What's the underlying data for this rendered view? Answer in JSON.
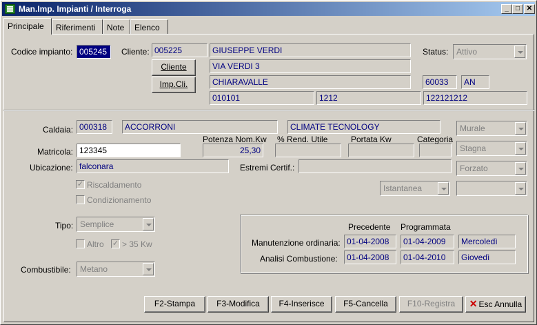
{
  "window": {
    "title": "Man.Imp. Impianti / Interroga",
    "min": "_",
    "max": "□",
    "close": "✕"
  },
  "tabs": [
    "Principale",
    "Riferimenti",
    "Note",
    "Elenco"
  ],
  "top": {
    "codice_label": "Codice impianto:",
    "codice_value": "005245",
    "cliente_label": "Cliente:",
    "cliente_code": "005225",
    "cliente_name": "GIUSEPPE VERDI",
    "status_label": "Status:",
    "status_value": "Attivo",
    "address": "VIA VERDI 3",
    "city": "CHIARAVALLE",
    "cap": "60033",
    "prov": "AN",
    "cliente_btn": "Cliente",
    "impcli_btn": "Imp.Cli.",
    "f1": "010101",
    "f2": "1212",
    "f3": "122121212"
  },
  "caldaia": {
    "label": "Caldaia:",
    "code": "000318",
    "brand": "ACCORRONI",
    "model": "CLIMATE TECNOLOGY",
    "combo1": "Murale",
    "matricola_label": "Matricola:",
    "matricola": "123345",
    "potenza_label": "Potenza Nom.Kw",
    "potenza": "25,30",
    "rend_label": "% Rend. Utile",
    "portata_label": "Portata Kw",
    "categoria_label": "Categoria",
    "combo2": "Stagna",
    "ubicazione_label": "Ubicazione:",
    "ubicazione": "falconara",
    "estremi_label": "Estremi Certif.:",
    "combo3": "Forzato",
    "riscaldamento": "Riscaldamento",
    "condizionamento": "Condizionamento",
    "istantanea": "Istantanea",
    "combo4": ""
  },
  "tipo": {
    "label": "Tipo:",
    "value": "Semplice",
    "altro": "Altro",
    "gt35": "> 35 Kw",
    "combustibile_label": "Combustibile:",
    "combustibile": "Metano"
  },
  "manut": {
    "precedente": "Precedente",
    "programmata": "Programmata",
    "ordinaria_label": "Manutenzione ordinaria:",
    "ord_prec": "01-04-2008",
    "ord_prog": "01-04-2009",
    "ord_day": "Mercoledì",
    "analisi_label": "Analisi Combustione:",
    "an_prec": "01-04-2008",
    "an_prog": "01-04-2010",
    "an_day": "Giovedì"
  },
  "buttons": {
    "stampa": "F2-Stampa",
    "modifica": "F3-Modifica",
    "inserisce": "F4-Inserisce",
    "cancella": "F5-Cancella",
    "registra": "F10-Registra",
    "annulla": "Esc Annulla"
  }
}
